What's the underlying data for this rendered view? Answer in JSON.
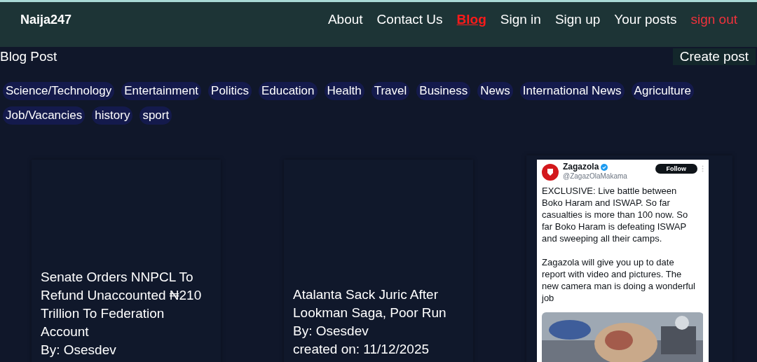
{
  "brand": "Naija247",
  "nav": [
    {
      "label": "About",
      "kind": "link",
      "selected": false
    },
    {
      "label": "Contact Us",
      "kind": "link",
      "selected": false
    },
    {
      "label": "Blog",
      "kind": "link",
      "selected": true
    },
    {
      "label": "Sign in",
      "kind": "link",
      "selected": false
    },
    {
      "label": "Sign up",
      "kind": "link",
      "selected": false
    },
    {
      "label": "Your posts",
      "kind": "link",
      "selected": false
    },
    {
      "label": "sign out",
      "kind": "danger",
      "selected": false
    }
  ],
  "heading": "Blog Post",
  "create_button": "Create post",
  "categories": [
    "Science/Technology",
    "Entertainment",
    "Politics",
    "Education",
    "Health",
    "Travel",
    "Business",
    "News",
    "International News",
    "Agriculture",
    "Job/Vacancies",
    "history",
    "sport"
  ],
  "posts": [
    {
      "kind": "article",
      "title": "Senate Orders NNPCL To Refund Unaccounted ₦210 Trillion To Federation Account",
      "author": "By: Osesdev"
    },
    {
      "kind": "article",
      "title": "Atalanta Sack Juric After Lookman Saga, Poor Run",
      "author": "By: Osesdev",
      "created": "created on: 11/12/2025"
    },
    {
      "kind": "tweet",
      "name": "Zagazola",
      "verified": true,
      "handle": "@ZagazOlaMakama",
      "follow": "Follow",
      "paragraphs": [
        "EXCLUSIVE: Live battle between Boko Haram and ISWAP. So far casualties is more than 100 now. So far Boko Haram is defeating ISWAP and sweeping all their camps.",
        "Zagazola will give you up to date report with video and pictures. The new camera man is doing a wonderful job"
      ]
    }
  ]
}
